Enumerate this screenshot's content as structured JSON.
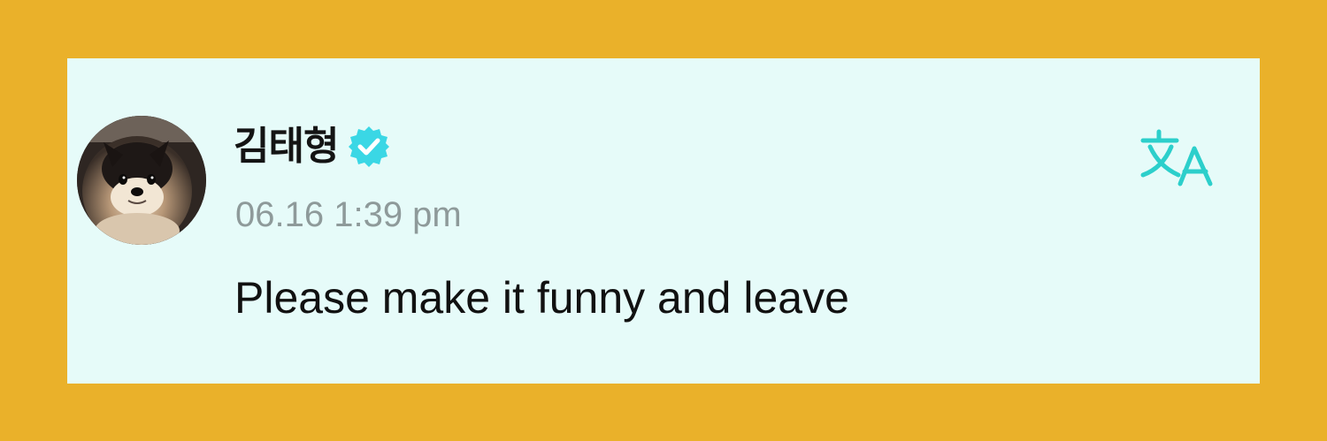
{
  "post": {
    "username": "김태형",
    "timestamp": "06.16 1:39 pm",
    "message": "Please make it funny and leave"
  },
  "icons": {
    "verified": "verified-badge-icon",
    "translate": "translate-icon",
    "avatar": "profile-photo"
  },
  "colors": {
    "background": "#EAB12A",
    "card": "#E6FBF9",
    "accent": "#2CCFCB",
    "verified": "#3AD7E5",
    "timestamp": "#8E9A9A",
    "text": "#111111"
  }
}
